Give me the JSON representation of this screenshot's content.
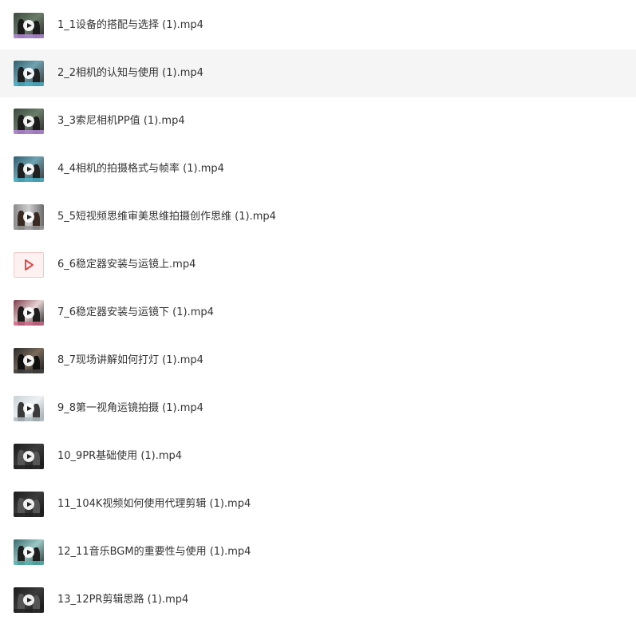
{
  "files": [
    {
      "name": "1_1设备的搭配与选择 (1).mp4",
      "thumb_icon": "video-thumbnail-icon",
      "thumb_tone": "purple"
    },
    {
      "name": "2_2相机的认知与使用 (1).mp4",
      "thumb_icon": "video-thumbnail-icon",
      "thumb_tone": "teal",
      "hovered": true
    },
    {
      "name": "3_3索尼相机PP值 (1).mp4",
      "thumb_icon": "video-thumbnail-icon",
      "thumb_tone": "purple"
    },
    {
      "name": "4_4相机的拍摄格式与帧率 (1).mp4",
      "thumb_icon": "video-thumbnail-icon",
      "thumb_tone": "teal"
    },
    {
      "name": "5_5短视频思维审美思维拍摄创作思维 (1).mp4",
      "thumb_icon": "video-thumbnail-icon",
      "thumb_tone": "grey"
    },
    {
      "name": "6_6稳定器安装与运镜上.mp4",
      "thumb_icon": "video-file-icon",
      "thumb_tone": "placeholder"
    },
    {
      "name": "7_6稳定器安装与运镜下 (1).mp4",
      "thumb_icon": "video-thumbnail-icon",
      "thumb_tone": "pink"
    },
    {
      "name": "8_7现场讲解如何打灯 (1).mp4",
      "thumb_icon": "video-thumbnail-icon",
      "thumb_tone": "dark"
    },
    {
      "name": "9_8第一视角运镜拍摄 (1).mp4",
      "thumb_icon": "video-thumbnail-icon",
      "thumb_tone": "light"
    },
    {
      "name": "10_9PR基础使用 (1).mp4",
      "thumb_icon": "video-thumbnail-icon",
      "thumb_tone": "black"
    },
    {
      "name": "11_104K视频如何使用代理剪辑 (1).mp4",
      "thumb_icon": "video-thumbnail-icon",
      "thumb_tone": "black"
    },
    {
      "name": "12_11音乐BGM的重要性与使用 (1).mp4",
      "thumb_icon": "video-thumbnail-icon",
      "thumb_tone": "cyan"
    },
    {
      "name": "13_12PR剪辑思路 (1).mp4",
      "thumb_icon": "video-thumbnail-icon",
      "thumb_tone": "black"
    }
  ],
  "colors": {
    "text": "#333333",
    "hover_bg": "#f5f5f5",
    "placeholder_accent": "#e04a4a"
  }
}
